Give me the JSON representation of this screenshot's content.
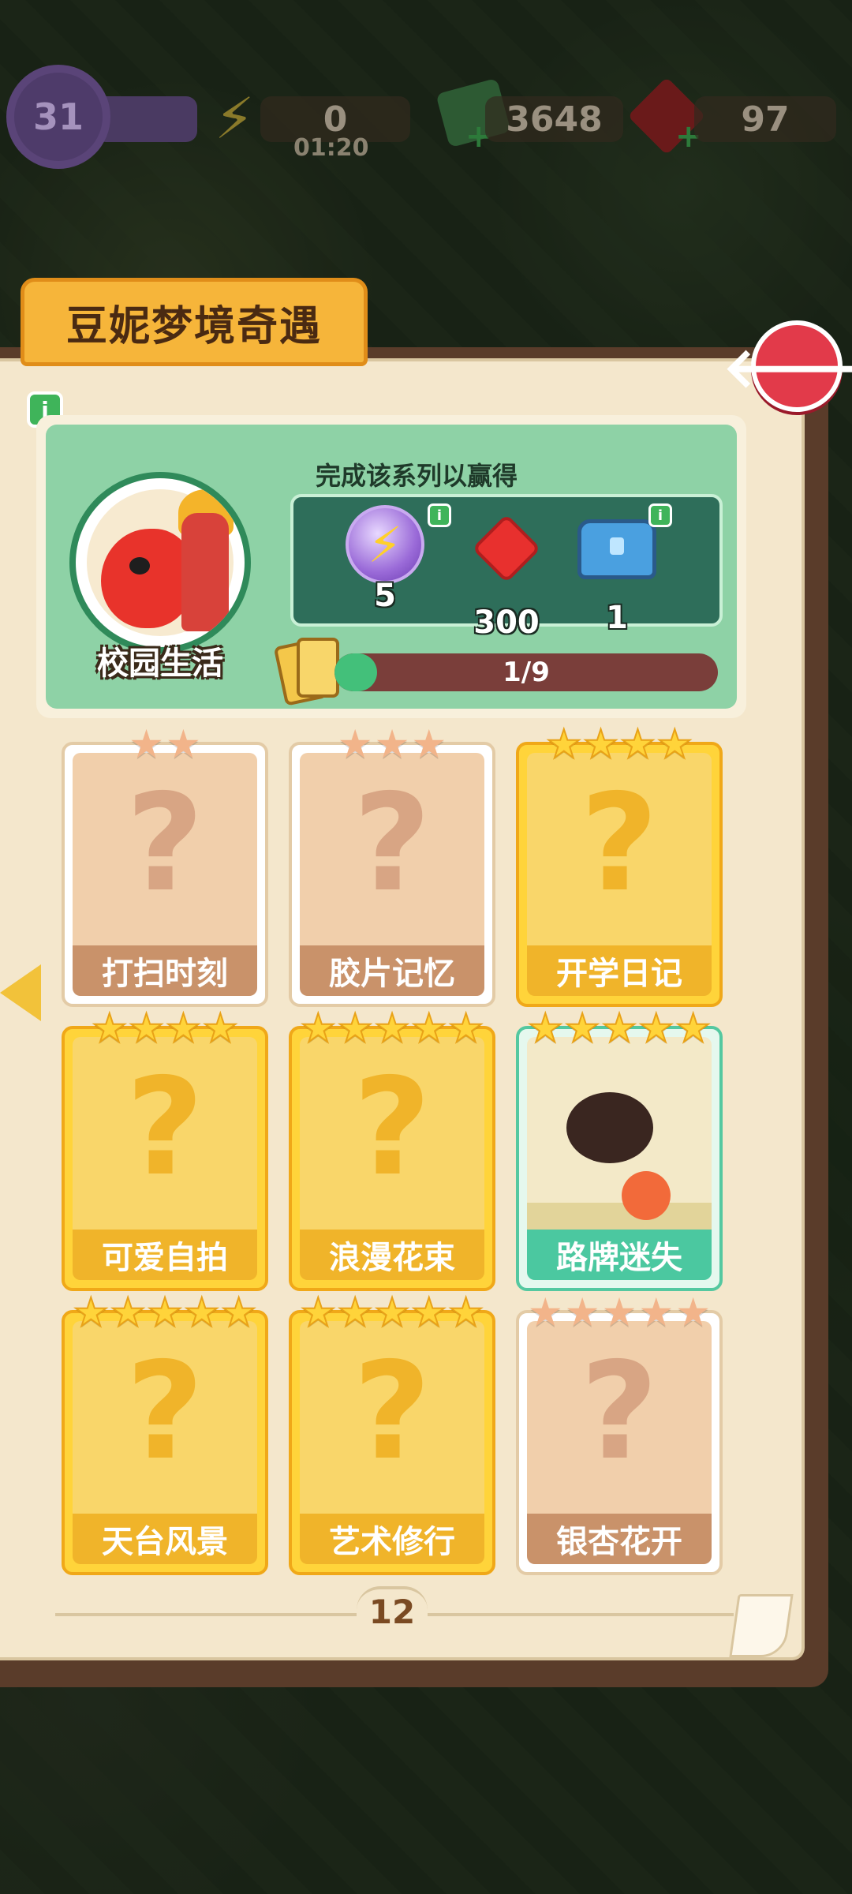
{
  "hud": {
    "level": "31",
    "energy": "0",
    "energy_timer": "01:20",
    "cash": "3648",
    "gems": "97"
  },
  "panel": {
    "title": "豆妮梦境奇遇",
    "page_number": "12"
  },
  "series": {
    "name": "校园生活",
    "complete_text": "完成该系列以赢得",
    "progress_text": "1/9",
    "progress": 0.111,
    "rewards": [
      {
        "icon": "energy-orb-icon",
        "qty": "5"
      },
      {
        "icon": "red-gem-icon",
        "qty": "300"
      },
      {
        "icon": "blue-chest-icon",
        "qty": "1"
      }
    ]
  },
  "cards": [
    {
      "label": "打扫时刻",
      "stars": 2,
      "style": "tan",
      "unlocked": false
    },
    {
      "label": "胶片记忆",
      "stars": 3,
      "style": "tan",
      "unlocked": false
    },
    {
      "label": "开学日记",
      "stars": 4,
      "style": "gold",
      "unlocked": false
    },
    {
      "label": "可爱自拍",
      "stars": 4,
      "style": "gold",
      "unlocked": false
    },
    {
      "label": "浪漫花束",
      "stars": 5,
      "style": "gold",
      "unlocked": false
    },
    {
      "label": "路牌迷失",
      "stars": 5,
      "style": "teal",
      "unlocked": true
    },
    {
      "label": "天台风景",
      "stars": 5,
      "style": "gold",
      "unlocked": false
    },
    {
      "label": "艺术修行",
      "stars": 5,
      "style": "gold",
      "unlocked": false
    },
    {
      "label": "银杏花开",
      "stars": 5,
      "style": "tan",
      "unlocked": false
    }
  ],
  "glyphs": {
    "star": "★",
    "question": "?",
    "bolt": "⚡",
    "back_arrow": "🡐",
    "info": "i",
    "plus": "+"
  },
  "colors": {
    "title_tab": "#f6b53a",
    "back_button": "#e23a4a",
    "progress_fill": "#43c07a",
    "reward_panel": "#2e6e5a"
  }
}
